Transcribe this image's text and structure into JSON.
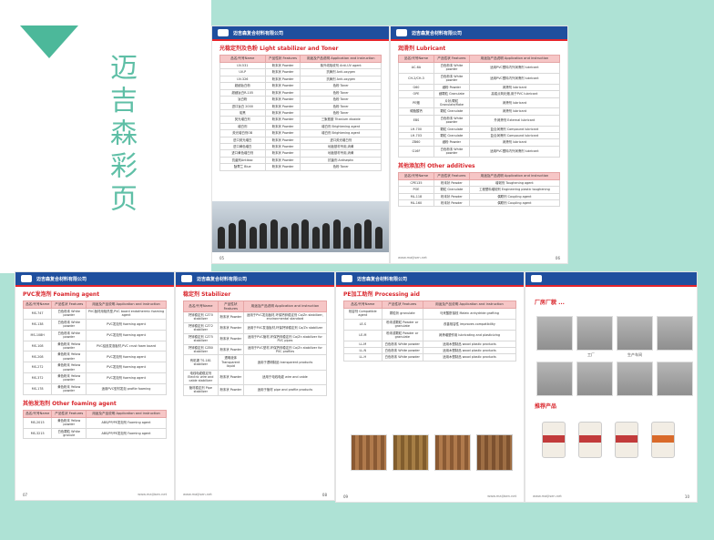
{
  "cover": {
    "title": "迈吉森彩页"
  },
  "company": {
    "name_cn": "迈吉森复合材料有限公司",
    "name_en": "Maijisen Composite Materials Co., Ltd."
  },
  "footer": {
    "web1": "www.maijisen.net",
    "web2": "www.maijisen.cn.alibaba.com"
  },
  "col_headers": [
    "品名/代号Name",
    "产品性状 Features",
    "用途及产品说明 Application and instruction"
  ],
  "page1": {
    "title": "光稳定剂及色粉 Light stabilizer and Toner",
    "rows": [
      [
        "UV-531",
        "粉末状 Powder",
        "紫外线吸收剂 Anti-UV agent"
      ],
      [
        "UV-P",
        "粉末状 Powder",
        "抗黄剂 Anti-oxygen"
      ],
      [
        "UV-326",
        "粉末状 Powder",
        "抗黄剂 Anti-oxygen"
      ],
      [
        "超细钛白粉",
        "粉末状 Powder",
        "色粉 Toner"
      ],
      [
        "超细钛白R-105",
        "粉末状 Powder",
        "色粉 Toner"
      ],
      [
        "钛白粉",
        "粉末状 Powder",
        "色粉 Toner"
      ],
      [
        "进口钛白 2000",
        "粉末状 Powder",
        "色粉 Toner"
      ],
      [
        "炭黑",
        "粉末状 Powder",
        "色粉 Toner"
      ],
      [
        "荧光增白剂",
        "粉末状 Powder",
        "三聚氰胺 Titanium dioxide"
      ],
      [
        "增白剂",
        "粉末状 Powder",
        "增白剂 Brightening agent"
      ],
      [
        "荧光增白剂OB",
        "粉末状 Powder",
        "增白剂 Brightening agent"
      ],
      [
        "进口荧光增白",
        "粉末状 Powder",
        "进口荧光增白剂"
      ],
      [
        "进口黄色增白",
        "粉末状 Powder",
        "地板基材专用,消黄"
      ],
      [
        "进口黄色增白剂",
        "粉末状 Powder",
        "地板基材专用,消黄"
      ],
      [
        "抗菌剂Antibac",
        "粉末状 Powder",
        "抗菌剂 Antiseptic"
      ],
      [
        "酞菁兰 Blue",
        "粉末状 Powder",
        "色粉 Toner"
      ]
    ]
  },
  "page2": {
    "title": "润滑剂 Lubricant",
    "rows": [
      [
        "AC-6A",
        "白色粉末 White powder",
        "适用PVC塑料内外润滑剂 lubricant"
      ],
      [
        "CH-2/CH-3",
        "白色粉末 White powder",
        "适用PVC塑料内外润滑剂 lubricant"
      ],
      [
        "G60",
        "细粉 Powder",
        "润滑剂 lubricant"
      ],
      [
        "OPE",
        "细颗粒 Granulate",
        "高熔点氧化蜡,用于PVC lubricant"
      ],
      [
        "PE蜡",
        "片状/颗粒 Granulate/flake",
        "润滑剂 lubricant"
      ],
      [
        "硬脂酸钙",
        "颗粒 Granulate",
        "润滑剂 lubricant"
      ],
      [
        "EBS",
        "白色粉末 White powder",
        "外润滑剂 External lubricant"
      ],
      [
        "LH-700",
        "颗粒 Granulate",
        "复合润滑剂 Compound lubricant"
      ],
      [
        "LH-703",
        "颗粒 Granulate",
        "复合润滑剂 Compound lubricant"
      ],
      [
        "ZB60",
        "细粉 Powder",
        "润滑剂 lubricant"
      ],
      [
        "G16F",
        "白色粉末 White powder",
        "适用PVC塑料内外润滑剂 lubricant"
      ]
    ],
    "title2": "其他添加剂 Other additives",
    "rows2": [
      [
        "CPE135",
        "粉末状 Powder",
        "增韧剂 Toughening agent"
      ],
      [
        "POE",
        "颗粒 Granulate",
        "工程塑料增韧剂 Engineering plastic toughening"
      ],
      [
        "ML-118",
        "粉末状 Powder",
        "偶联剂 Coupling agent"
      ],
      [
        "ML-160",
        "粉末状 Powder",
        "偶联剂 Coupling agent"
      ]
    ]
  },
  "page3": {
    "title": "PVC发泡剂 Foaming agent",
    "rows": [
      [
        "MS-747",
        "白色粉末 White powder",
        "PVC板材用吸热型,PVC board endothermic foaming agent"
      ],
      [
        "MS-138",
        "白色粉末 White powder",
        "PVC发泡剂 foaming agent"
      ],
      [
        "MS-108H",
        "白色粉末 White powder",
        "PVC发泡剂 foaming agent"
      ],
      [
        "MS-108",
        "黄色粉末 Yellow powder",
        "PVC结皮发泡板材,PVC crust foam board"
      ],
      [
        "MS-208",
        "黄色粉末 Yellow powder",
        "PVC发泡剂 foaming agent"
      ],
      [
        "MS-272",
        "黄色粉末 Yellow powder",
        "PVC发泡剂 foaming agent"
      ],
      [
        "MS-372",
        "黄色粉末 Yellow powder",
        "PVC发泡剂 foaming agent"
      ],
      [
        "MS-178",
        "黄色粉末 Yellow powder",
        "适用PVC型材发泡 profile foaming"
      ]
    ],
    "title2": "其他发泡剂 Other foaming agent",
    "rows2": [
      [
        "MS-2015",
        "黄色粉末 Yellow powder",
        "ABS/PP/PE发泡剂 Foaming agent"
      ],
      [
        "MS-3215",
        "白色颗粒 White granule",
        "ABS/PP/PE发泡剂 Foaming agent"
      ]
    ]
  },
  "page4": {
    "title": "稳定剂 Stabilizer",
    "rows": [
      [
        "钙锌稳定剂 CZ70 stabilizer",
        "粉末状 Powder",
        "适用于PVC发泡板材,环保钙锌稳定剂 Ca/Zn stabilizer, environmental standard"
      ],
      [
        "钙锌稳定剂 CZ72 stabilizer",
        "粉末状 Powder",
        "适用于PVC发泡板材,环保钙锌稳定剂 Ca/Zn stabilizer"
      ],
      [
        "钙锌稳定剂 CZ75 stabilizer",
        "粉末状 Powder",
        "适用于PVC管材,环保钙锌稳定剂 Ca/Zn stabilizer for PVC pipes"
      ],
      [
        "钙锌稳定剂 CZ80 stabilizer",
        "粉末状 Powder",
        "适用于PVC型材,环保钙锌稳定剂 Ca/Zn stabilizer for PVC profiles"
      ],
      [
        "有机锡 TS-181 stabilizer",
        "透明液体 Transparent liquid",
        "适用于透明制品 transparent products"
      ],
      [
        "电线电缆稳定剂 Electric wire and cable stabilizer",
        "粉末状 Powder",
        "适用于电线电缆 wire and cable"
      ],
      [
        "管材稳定剂 Pipe stabilizer",
        "粉末状 Powder",
        "适用于管材 pipe and profile products"
      ]
    ]
  },
  "page5": {
    "title": "PE加工助剂 Processing aid",
    "rows": [
      [
        "相容剂 Compatible agent",
        "颗粒状 granulate",
        "马来酸酐接枝 Maleic anhydride grafting"
      ],
      [
        "LE-S",
        "粉末或颗粒 Powder or granulate",
        "改善相容性 improves compatibility"
      ],
      [
        "LE-M",
        "粉末或颗粒 Powder or granulate",
        "润滑增塑作用 lubricating and plasticizing"
      ],
      [
        "LL-M",
        "白色粉末 White powder",
        "适用木塑制品 wood plastic products"
      ],
      [
        "LL-N",
        "白色粉末 White powder",
        "适用木塑制品 wood plastic products"
      ],
      [
        "LL-H",
        "白色粉末 White powder",
        "适用木塑制品 wood plastic products"
      ]
    ]
  },
  "page6": {
    "title": "厂房厂貌 ...",
    "captions": [
      "工厂",
      "生产车间"
    ],
    "title2": "推荐产品"
  },
  "page_numbers": [
    "05",
    "06",
    "07",
    "08",
    "09",
    "10"
  ]
}
